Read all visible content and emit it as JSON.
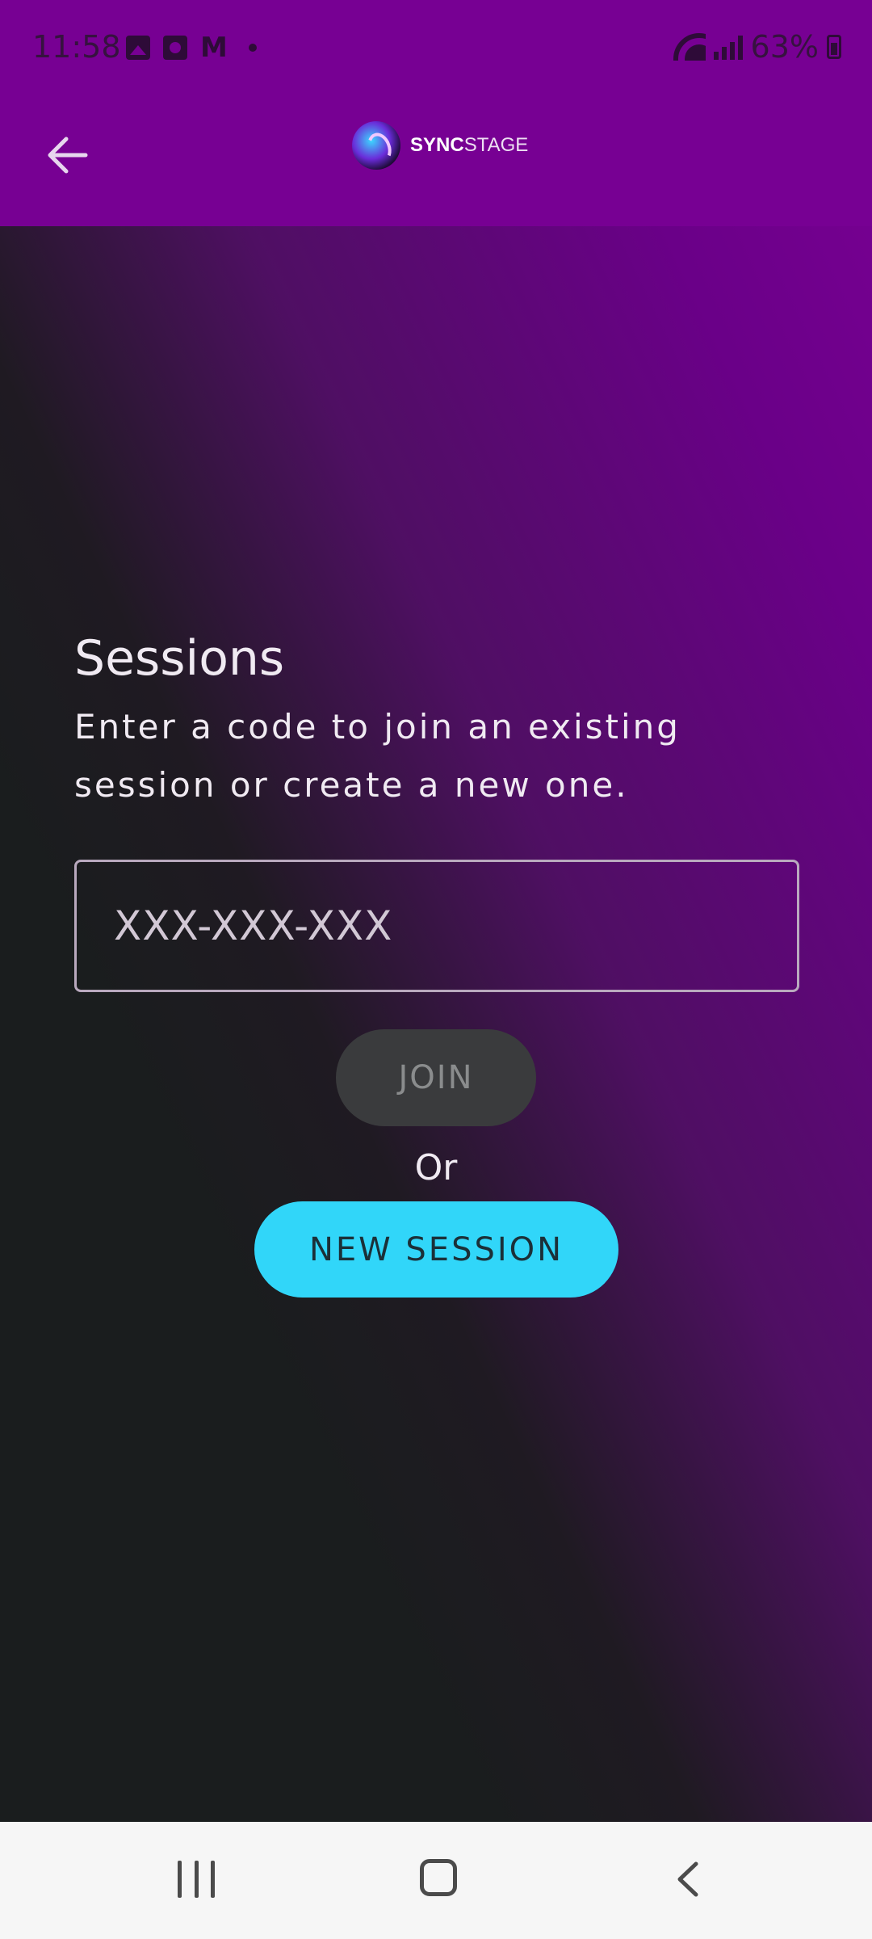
{
  "status_bar": {
    "time": "11:58",
    "battery": "63%",
    "icons": [
      "gallery-icon",
      "camera-icon",
      "gmail-icon",
      "notification-dot-icon",
      "wifi-icon",
      "signal-icon",
      "battery-icon"
    ]
  },
  "app_bar": {
    "back_icon": "arrow-left-icon",
    "logo_bold": "SYNC",
    "logo_light": "STAGE"
  },
  "sessions": {
    "title": "Sessions",
    "subtitle": "Enter a code to join an existing session or create a new one.",
    "code_placeholder": "XXX-XXX-XXX",
    "code_value": "",
    "join_label": "JOIN",
    "or_label": "Or",
    "new_session_label": "NEW SESSION"
  },
  "colors": {
    "app_bar": "#770093",
    "accent": "#31d6f9",
    "disabled_button": "#3a3b3d",
    "background": "#1a1d1e"
  },
  "nav_bar": {
    "icons": [
      "recent-apps-icon",
      "home-icon",
      "back-icon"
    ]
  }
}
